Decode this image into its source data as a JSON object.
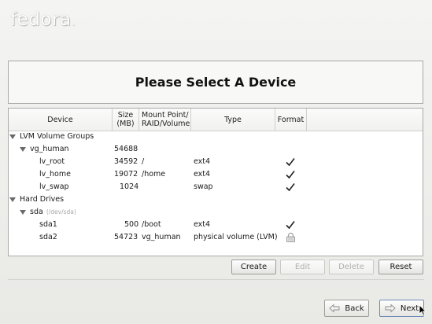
{
  "brand": {
    "logo": "fedora",
    "logo_mark": "."
  },
  "header": {
    "title": "Please Select A Device"
  },
  "table": {
    "columns": {
      "device": "Device",
      "size": "Size\n(MB)",
      "mount": "Mount Point/\nRAID/Volume",
      "type": "Type",
      "format": "Format"
    },
    "rows": [
      {
        "device": "LVM Volume Groups",
        "size": "",
        "mount": "",
        "type": "",
        "format": ""
      },
      {
        "device": "vg_human",
        "size": "54688",
        "mount": "",
        "type": "",
        "format": ""
      },
      {
        "device": "lv_root",
        "size": "34592",
        "mount": "/",
        "type": "ext4",
        "format": "check"
      },
      {
        "device": "lv_home",
        "size": "19072",
        "mount": "/home",
        "type": "ext4",
        "format": "check"
      },
      {
        "device": "lv_swap",
        "size": "1024",
        "mount": "",
        "type": "swap",
        "format": "check"
      },
      {
        "device": "Hard Drives",
        "size": "",
        "mount": "",
        "type": "",
        "format": ""
      },
      {
        "device": "sda",
        "device_sub": "(/dev/sda)",
        "size": "",
        "mount": "",
        "type": "",
        "format": ""
      },
      {
        "device": "sda1",
        "size": "500",
        "mount": "/boot",
        "type": "ext4",
        "format": "check"
      },
      {
        "device": "sda2",
        "size": "54723",
        "mount": "vg_human",
        "type": "physical volume (LVM)",
        "format": "lock"
      }
    ]
  },
  "actions": {
    "create": "Create",
    "edit": "Edit",
    "delete": "Delete",
    "reset": "Reset"
  },
  "navigation": {
    "back": "Back",
    "next": "Next"
  }
}
